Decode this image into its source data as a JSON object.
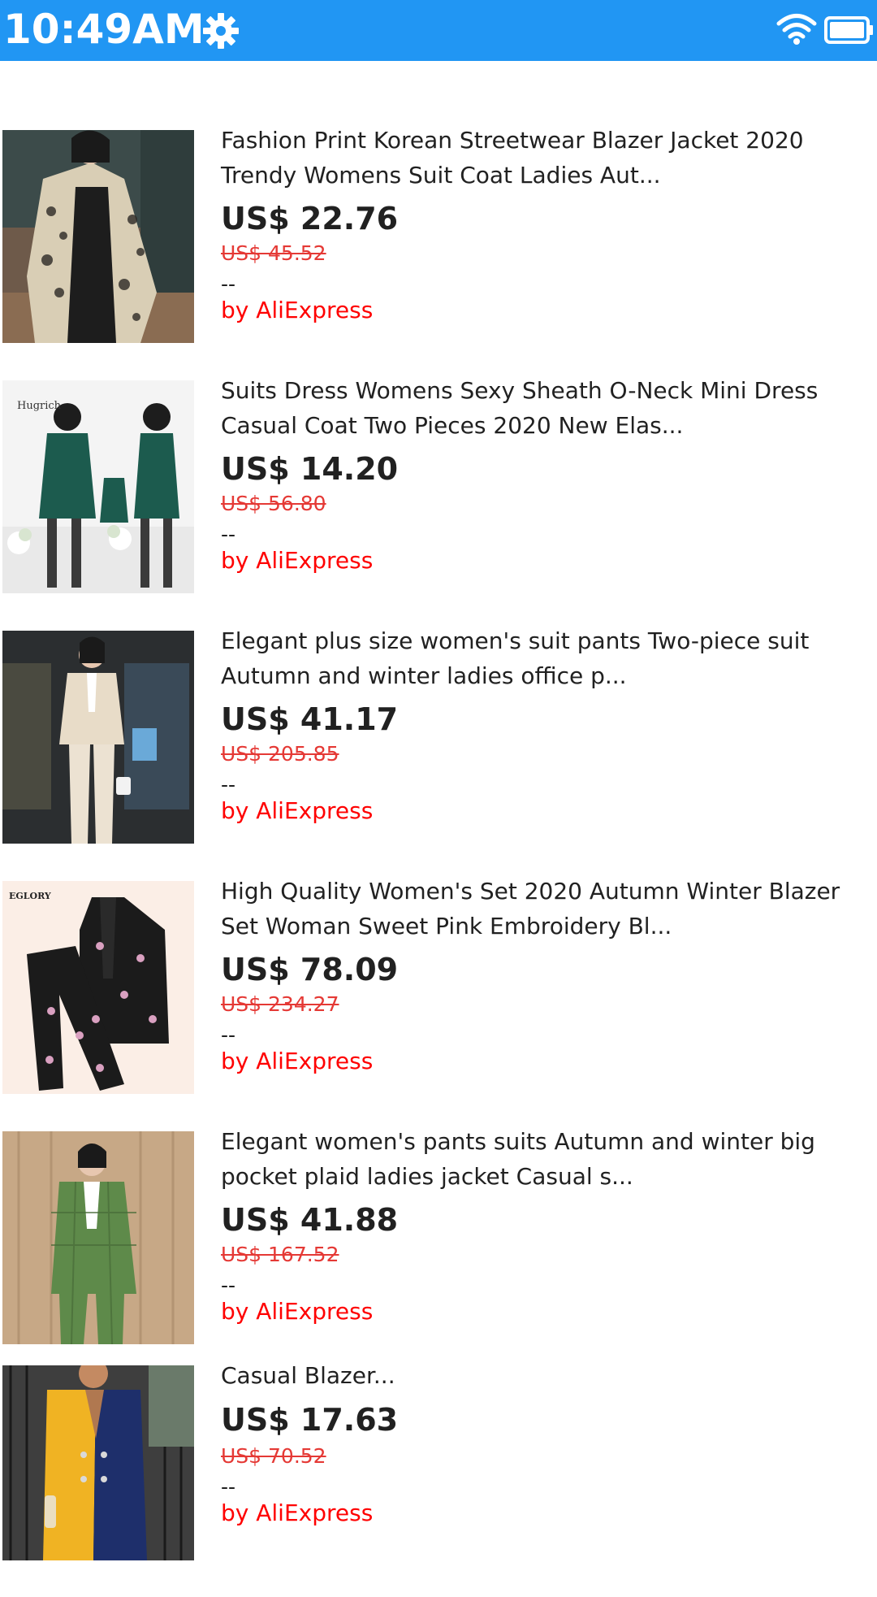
{
  "status_bar": {
    "time": "10:49AM",
    "background_color": "#2196f3",
    "icons": [
      "gear-icon",
      "wifi-icon",
      "battery-icon"
    ]
  },
  "products": [
    {
      "title": "Fashion Print Korean Streetwear Blazer Jacket 2020 Trendy Womens Suit Coat Ladies Aut...",
      "price": "US$ 22.76",
      "original_price": "US$ 45.52",
      "rating": "--",
      "seller": "by AliExpress"
    },
    {
      "title": "Suits Dress Womens Sexy Sheath O-Neck Mini Dress Casual Coat Two Pieces 2020 New Elas...",
      "price": "US$ 14.20",
      "original_price": "US$ 56.80",
      "rating": "--",
      "seller": "by AliExpress",
      "image_text": "Hugrich"
    },
    {
      "title": "Elegant plus size women's suit pants Two-piece suit Autumn and winter ladies office p...",
      "price": "US$ 41.17",
      "original_price": "US$ 205.85",
      "rating": "--",
      "seller": "by AliExpress"
    },
    {
      "title": "High Quality Women's Set 2020 Autumn Winter Blazer Set Woman Sweet Pink Embroidery Bl...",
      "price": "US$ 78.09",
      "original_price": "US$ 234.27",
      "rating": "--",
      "seller": "by AliExpress",
      "image_text": "EGLORY"
    },
    {
      "title": "Elegant women's pants suits Autumn and winter big pocket plaid ladies jacket Casual s...",
      "price": "US$ 41.88",
      "original_price": "US$ 167.52",
      "rating": "--",
      "seller": "by AliExpress"
    },
    {
      "title": "Casual Blazer...",
      "price": "US$ 17.63",
      "original_price": "US$ 70.52",
      "rating": "--",
      "seller": "by AliExpress"
    }
  ],
  "colors": {
    "price": "#212121",
    "original_price": "#e53935",
    "seller": "#ff0000"
  }
}
